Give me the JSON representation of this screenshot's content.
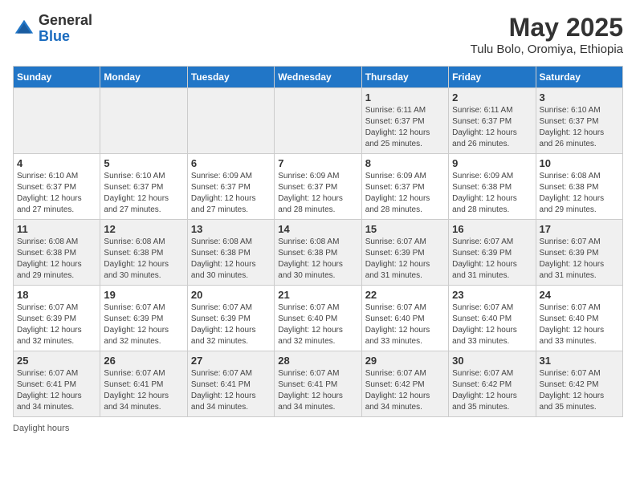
{
  "header": {
    "logo_line1": "General",
    "logo_line2": "Blue",
    "title": "May 2025",
    "subtitle": "Tulu Bolo, Oromiya, Ethiopia"
  },
  "days_of_week": [
    "Sunday",
    "Monday",
    "Tuesday",
    "Wednesday",
    "Thursday",
    "Friday",
    "Saturday"
  ],
  "weeks": [
    [
      {
        "day": "",
        "info": ""
      },
      {
        "day": "",
        "info": ""
      },
      {
        "day": "",
        "info": ""
      },
      {
        "day": "",
        "info": ""
      },
      {
        "day": "1",
        "info": "Sunrise: 6:11 AM\nSunset: 6:37 PM\nDaylight: 12 hours\nand 25 minutes."
      },
      {
        "day": "2",
        "info": "Sunrise: 6:11 AM\nSunset: 6:37 PM\nDaylight: 12 hours\nand 26 minutes."
      },
      {
        "day": "3",
        "info": "Sunrise: 6:10 AM\nSunset: 6:37 PM\nDaylight: 12 hours\nand 26 minutes."
      }
    ],
    [
      {
        "day": "4",
        "info": "Sunrise: 6:10 AM\nSunset: 6:37 PM\nDaylight: 12 hours\nand 27 minutes."
      },
      {
        "day": "5",
        "info": "Sunrise: 6:10 AM\nSunset: 6:37 PM\nDaylight: 12 hours\nand 27 minutes."
      },
      {
        "day": "6",
        "info": "Sunrise: 6:09 AM\nSunset: 6:37 PM\nDaylight: 12 hours\nand 27 minutes."
      },
      {
        "day": "7",
        "info": "Sunrise: 6:09 AM\nSunset: 6:37 PM\nDaylight: 12 hours\nand 28 minutes."
      },
      {
        "day": "8",
        "info": "Sunrise: 6:09 AM\nSunset: 6:37 PM\nDaylight: 12 hours\nand 28 minutes."
      },
      {
        "day": "9",
        "info": "Sunrise: 6:09 AM\nSunset: 6:38 PM\nDaylight: 12 hours\nand 28 minutes."
      },
      {
        "day": "10",
        "info": "Sunrise: 6:08 AM\nSunset: 6:38 PM\nDaylight: 12 hours\nand 29 minutes."
      }
    ],
    [
      {
        "day": "11",
        "info": "Sunrise: 6:08 AM\nSunset: 6:38 PM\nDaylight: 12 hours\nand 29 minutes."
      },
      {
        "day": "12",
        "info": "Sunrise: 6:08 AM\nSunset: 6:38 PM\nDaylight: 12 hours\nand 30 minutes."
      },
      {
        "day": "13",
        "info": "Sunrise: 6:08 AM\nSunset: 6:38 PM\nDaylight: 12 hours\nand 30 minutes."
      },
      {
        "day": "14",
        "info": "Sunrise: 6:08 AM\nSunset: 6:38 PM\nDaylight: 12 hours\nand 30 minutes."
      },
      {
        "day": "15",
        "info": "Sunrise: 6:07 AM\nSunset: 6:39 PM\nDaylight: 12 hours\nand 31 minutes."
      },
      {
        "day": "16",
        "info": "Sunrise: 6:07 AM\nSunset: 6:39 PM\nDaylight: 12 hours\nand 31 minutes."
      },
      {
        "day": "17",
        "info": "Sunrise: 6:07 AM\nSunset: 6:39 PM\nDaylight: 12 hours\nand 31 minutes."
      }
    ],
    [
      {
        "day": "18",
        "info": "Sunrise: 6:07 AM\nSunset: 6:39 PM\nDaylight: 12 hours\nand 32 minutes."
      },
      {
        "day": "19",
        "info": "Sunrise: 6:07 AM\nSunset: 6:39 PM\nDaylight: 12 hours\nand 32 minutes."
      },
      {
        "day": "20",
        "info": "Sunrise: 6:07 AM\nSunset: 6:39 PM\nDaylight: 12 hours\nand 32 minutes."
      },
      {
        "day": "21",
        "info": "Sunrise: 6:07 AM\nSunset: 6:40 PM\nDaylight: 12 hours\nand 32 minutes."
      },
      {
        "day": "22",
        "info": "Sunrise: 6:07 AM\nSunset: 6:40 PM\nDaylight: 12 hours\nand 33 minutes."
      },
      {
        "day": "23",
        "info": "Sunrise: 6:07 AM\nSunset: 6:40 PM\nDaylight: 12 hours\nand 33 minutes."
      },
      {
        "day": "24",
        "info": "Sunrise: 6:07 AM\nSunset: 6:40 PM\nDaylight: 12 hours\nand 33 minutes."
      }
    ],
    [
      {
        "day": "25",
        "info": "Sunrise: 6:07 AM\nSunset: 6:41 PM\nDaylight: 12 hours\nand 34 minutes."
      },
      {
        "day": "26",
        "info": "Sunrise: 6:07 AM\nSunset: 6:41 PM\nDaylight: 12 hours\nand 34 minutes."
      },
      {
        "day": "27",
        "info": "Sunrise: 6:07 AM\nSunset: 6:41 PM\nDaylight: 12 hours\nand 34 minutes."
      },
      {
        "day": "28",
        "info": "Sunrise: 6:07 AM\nSunset: 6:41 PM\nDaylight: 12 hours\nand 34 minutes."
      },
      {
        "day": "29",
        "info": "Sunrise: 6:07 AM\nSunset: 6:42 PM\nDaylight: 12 hours\nand 34 minutes."
      },
      {
        "day": "30",
        "info": "Sunrise: 6:07 AM\nSunset: 6:42 PM\nDaylight: 12 hours\nand 35 minutes."
      },
      {
        "day": "31",
        "info": "Sunrise: 6:07 AM\nSunset: 6:42 PM\nDaylight: 12 hours\nand 35 minutes."
      }
    ]
  ],
  "footer": "Daylight hours"
}
